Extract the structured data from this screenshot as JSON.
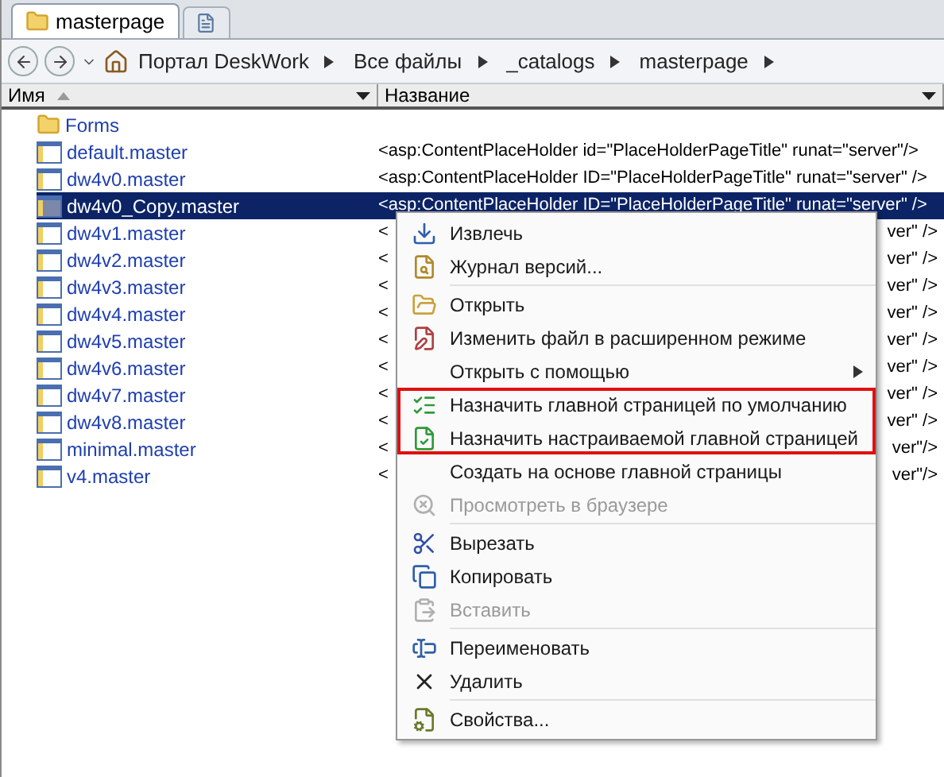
{
  "tabs": [
    {
      "label": "masterpage",
      "selected": true
    }
  ],
  "address_bar": {
    "breadcrumbs": [
      "Портал DeskWork",
      "Все файлы",
      "_catalogs",
      "masterpage"
    ]
  },
  "table": {
    "columns": [
      {
        "label": "Имя",
        "sorted": true
      },
      {
        "label": "Название",
        "sorted": false
      }
    ],
    "rows": [
      {
        "kind": "folder",
        "name": "Forms",
        "selected": false
      },
      {
        "kind": "file",
        "name": "default.master",
        "title": "<asp:ContentPlaceHolder id=\"PlaceHolderPageTitle\" runat=\"server\"/>",
        "selected": false
      },
      {
        "kind": "file",
        "name": "dw4v0.master",
        "title": "<asp:ContentPlaceHolder ID=\"PlaceHolderPageTitle\" runat=\"server\" />",
        "selected": false
      },
      {
        "kind": "file",
        "name": "dw4v0_Copy.master",
        "title": "<asp:ContentPlaceHolder ID=\"PlaceHolderPageTitle\" runat=\"server\" />",
        "selected": true
      },
      {
        "kind": "file",
        "name": "dw4v1.master",
        "title_start": "<",
        "title_end": "ver\" />",
        "selected": false
      },
      {
        "kind": "file",
        "name": "dw4v2.master",
        "title_start": "<",
        "title_end": "ver\" />",
        "selected": false
      },
      {
        "kind": "file",
        "name": "dw4v3.master",
        "title_start": "<",
        "title_end": "ver\" />",
        "selected": false
      },
      {
        "kind": "file",
        "name": "dw4v4.master",
        "title_start": "<",
        "title_end": "ver\" />",
        "selected": false
      },
      {
        "kind": "file",
        "name": "dw4v5.master",
        "title_start": "<",
        "title_end": "ver\" />",
        "selected": false
      },
      {
        "kind": "file",
        "name": "dw4v6.master",
        "title_start": "<",
        "title_end": "ver\" />",
        "selected": false
      },
      {
        "kind": "file",
        "name": "dw4v7.master",
        "title_start": "<",
        "title_end": "ver\" />",
        "selected": false
      },
      {
        "kind": "file",
        "name": "dw4v8.master",
        "title_start": "<",
        "title_end": "ver\" />",
        "selected": false
      },
      {
        "kind": "file",
        "name": "minimal.master",
        "title_start": "<",
        "title_end": "ver\"/>",
        "selected": false
      },
      {
        "kind": "file",
        "name": "v4.master",
        "title_start": "<",
        "title_end": "ver\"/>",
        "selected": false
      }
    ]
  },
  "context_menu": [
    {
      "kind": "item",
      "label": "Извлечь",
      "disabled": false,
      "submenu": false,
      "highlighted": false
    },
    {
      "kind": "item",
      "label": "Журнал версий...",
      "disabled": false,
      "submenu": false,
      "highlighted": false
    },
    {
      "kind": "separator"
    },
    {
      "kind": "item",
      "label": "Открыть",
      "disabled": false,
      "submenu": false,
      "highlighted": false
    },
    {
      "kind": "item",
      "label": "Изменить файл в расширенном режиме",
      "disabled": false,
      "submenu": false,
      "highlighted": false
    },
    {
      "kind": "item",
      "label": "Открыть с помощью",
      "disabled": false,
      "submenu": true,
      "highlighted": false
    },
    {
      "kind": "item",
      "label": "Назначить главной страницей по умолчанию",
      "disabled": false,
      "submenu": false,
      "highlighted": true
    },
    {
      "kind": "item",
      "label": "Назначить настраиваемой главной страницей",
      "disabled": false,
      "submenu": false,
      "highlighted": true
    },
    {
      "kind": "item",
      "label": "Создать на основе главной страницы",
      "disabled": false,
      "submenu": false,
      "highlighted": false
    },
    {
      "kind": "item",
      "label": "Просмотреть в браузере",
      "disabled": true,
      "submenu": false,
      "highlighted": false
    },
    {
      "kind": "separator"
    },
    {
      "kind": "item",
      "label": "Вырезать",
      "disabled": false,
      "submenu": false,
      "highlighted": false
    },
    {
      "kind": "item",
      "label": "Копировать",
      "disabled": false,
      "submenu": false,
      "highlighted": false
    },
    {
      "kind": "item",
      "label": "Вставить",
      "disabled": true,
      "submenu": false,
      "highlighted": false
    },
    {
      "kind": "separator"
    },
    {
      "kind": "item",
      "label": "Переименовать",
      "disabled": false,
      "submenu": false,
      "highlighted": false
    },
    {
      "kind": "item",
      "label": "Удалить",
      "disabled": false,
      "submenu": false,
      "highlighted": false
    },
    {
      "kind": "separator"
    },
    {
      "kind": "item",
      "label": "Свойства...",
      "disabled": false,
      "submenu": false,
      "highlighted": false
    }
  ]
}
